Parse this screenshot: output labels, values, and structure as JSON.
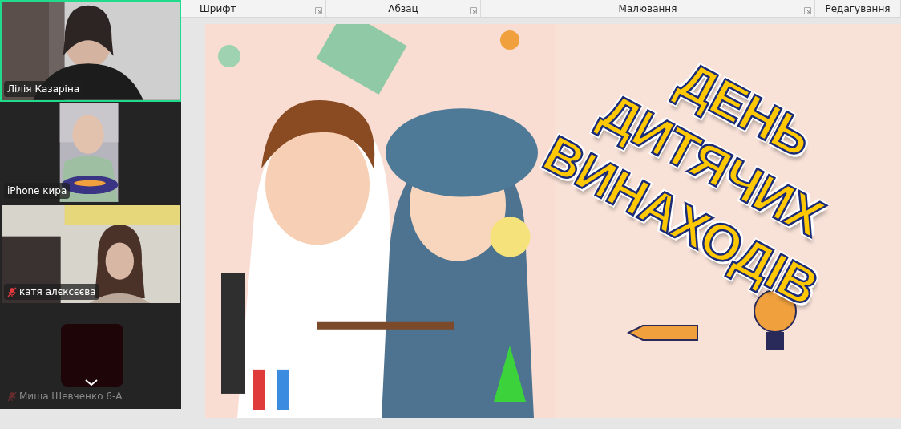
{
  "ribbon": {
    "groups": [
      {
        "label": "Шрифт",
        "launcher": true
      },
      {
        "label": "Абзац",
        "launcher": true
      },
      {
        "label": "Малювання",
        "launcher": true
      },
      {
        "label": "Редагування",
        "launcher": false
      }
    ]
  },
  "participants": [
    {
      "name": "Лілія Казаріна",
      "kind": "camera",
      "speaking": true,
      "muted": false
    },
    {
      "name": "iPhone кира",
      "kind": "portrait",
      "speaking": false,
      "muted": false
    },
    {
      "name": "катя алєксєєва",
      "kind": "camera",
      "speaking": false,
      "muted": true
    },
    {
      "name": "Миша Шевченко 6-А",
      "kind": "avatar",
      "speaking": false,
      "muted": true
    }
  ],
  "slide": {
    "title_lines": [
      "ДЕНЬ",
      "ДИТЯЧИХ",
      "ВИНАХОДІВ"
    ]
  }
}
